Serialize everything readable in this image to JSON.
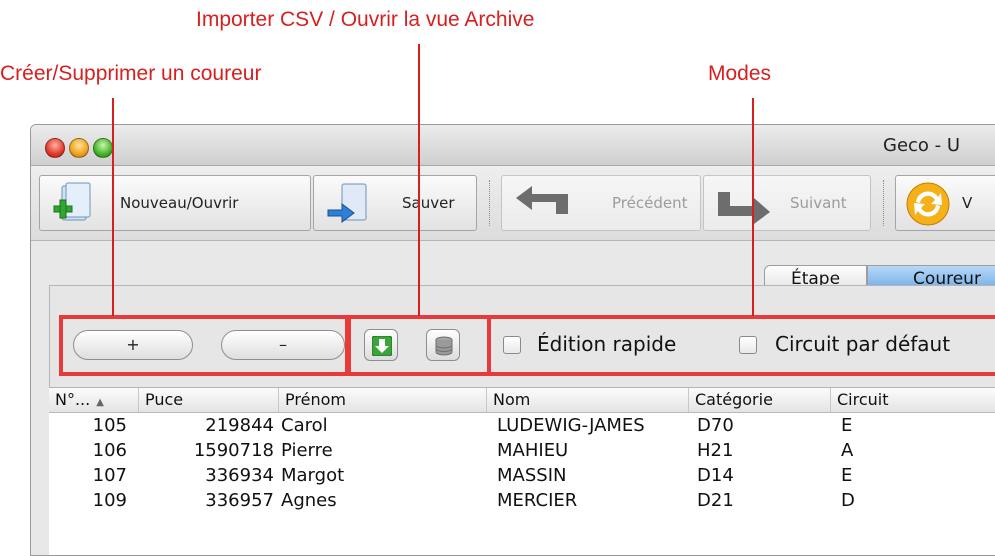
{
  "annotations": {
    "import_archive": "Importer CSV / Ouvrir la vue Archive",
    "create_delete": "Créer/Supprimer un coureur",
    "modes": "Modes"
  },
  "window": {
    "title": "Geco - U"
  },
  "toolbar": {
    "new_open": "Nouveau/Ouvrir",
    "save": "Sauver",
    "previous": "Précédent",
    "next": "Suivant",
    "refresh_partial": "V"
  },
  "tabs": {
    "etape": "Étape",
    "coureurs": "Coureur"
  },
  "runner_actions": {
    "add": "+",
    "remove": "–"
  },
  "modes": {
    "quick_edit": "Édition rapide",
    "default_course": "Circuit par défaut"
  },
  "table": {
    "columns": [
      "N°...",
      "Puce",
      "Prénom",
      "Nom",
      "Catégorie",
      "Circuit"
    ],
    "rows": [
      {
        "num": "105",
        "puce": "219844",
        "prenom": "Carol",
        "nom": "LUDEWIG-JAMES",
        "categorie": "D70",
        "circuit": "E"
      },
      {
        "num": "106",
        "puce": "1590718",
        "prenom": "Pierre",
        "nom": "MAHIEU",
        "categorie": "H21",
        "circuit": "A"
      },
      {
        "num": "107",
        "puce": "336934",
        "prenom": "Margot",
        "nom": "MASSIN",
        "categorie": "D14",
        "circuit": "E"
      },
      {
        "num": "109",
        "puce": "336957",
        "prenom": "Agnes",
        "nom": "MERCIER",
        "categorie": "D21",
        "circuit": "D"
      }
    ]
  },
  "colors": {
    "annotation": "#d81f1f",
    "highlight_box": "#e73b3b",
    "selected_tab": "#6aa9e6"
  }
}
